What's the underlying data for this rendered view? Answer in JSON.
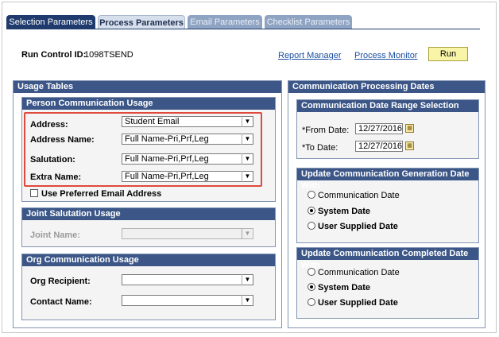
{
  "tabs": [
    {
      "label": "Selection Parameters"
    },
    {
      "label": "Process Parameters"
    },
    {
      "label": "Email Parameters"
    },
    {
      "label": "Checklist Parameters"
    }
  ],
  "header": {
    "run_control_label": "Run Control ID:",
    "run_control_value": "1098TSEND",
    "report_manager": "Report Manager",
    "process_monitor": "Process Monitor",
    "run_button": "Run"
  },
  "usage_tables": {
    "title": "Usage Tables",
    "person_comm": {
      "title": "Person Communication Usage",
      "address_label": "Address:",
      "address_value": "Student Email",
      "address_name_label": "Address Name:",
      "address_name_value": "Full Name-Pri,Prf,Leg",
      "salutation_label": "Salutation:",
      "salutation_value": "Full Name-Pri,Prf,Leg",
      "extra_name_label": "Extra Name:",
      "extra_name_value": "Full Name-Pri,Prf,Leg",
      "preferred_email_label": "Use Preferred Email Address"
    },
    "joint_salutation": {
      "title": "Joint Salutation Usage",
      "joint_name_label": "Joint Name:",
      "joint_name_value": ""
    },
    "org_comm": {
      "title": "Org Communication Usage",
      "org_recipient_label": "Org Recipient:",
      "org_recipient_value": "",
      "contact_name_label": "Contact Name:",
      "contact_name_value": ""
    }
  },
  "comm_dates": {
    "title": "Communication Processing Dates",
    "range": {
      "title": "Communication Date Range Selection",
      "from_label": "*From Date:",
      "from_value": "12/27/2016",
      "to_label": "*To Date:",
      "to_value": "12/27/2016"
    },
    "generation": {
      "title": "Update Communication Generation Date With",
      "options": [
        "Communication Date",
        "System Date",
        "User Supplied Date"
      ],
      "selected": 1
    },
    "completed": {
      "title": "Update Communication Completed Date With",
      "options": [
        "Communication Date",
        "System Date",
        "User Supplied Date"
      ],
      "selected": 1
    }
  }
}
